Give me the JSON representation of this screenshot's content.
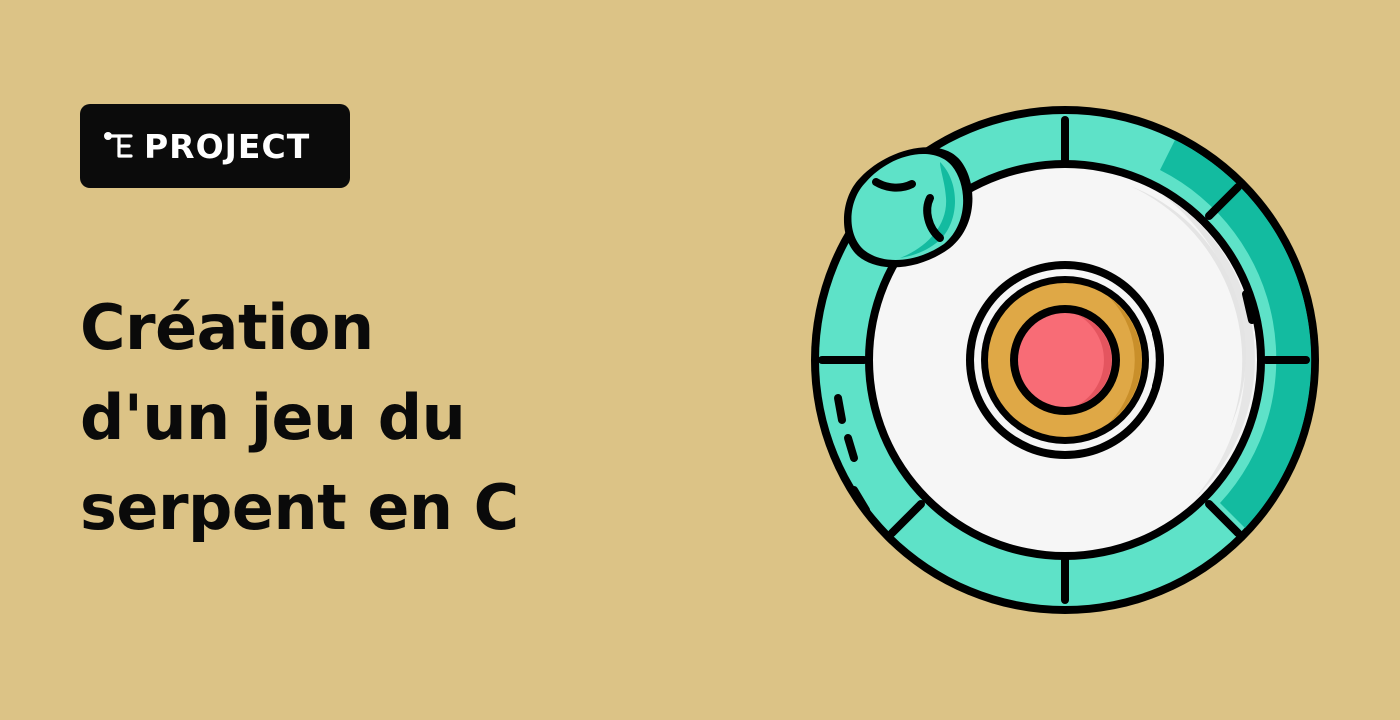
{
  "badge": {
    "icon": "project-icon",
    "label": "PROJECT"
  },
  "title": {
    "lines": [
      "Création",
      "d'un jeu du",
      "serpent en C"
    ]
  },
  "illustration": {
    "icon": "snake-ring-icon"
  },
  "colors": {
    "background": "#DCC386",
    "badge": "#0b0b0b",
    "snake": "#5EE2C8",
    "snake_shade": "#13BBA0",
    "disc": "#F6F6F6",
    "ring": "#DFA846",
    "center": "#F86C76",
    "outline": "#000000"
  }
}
